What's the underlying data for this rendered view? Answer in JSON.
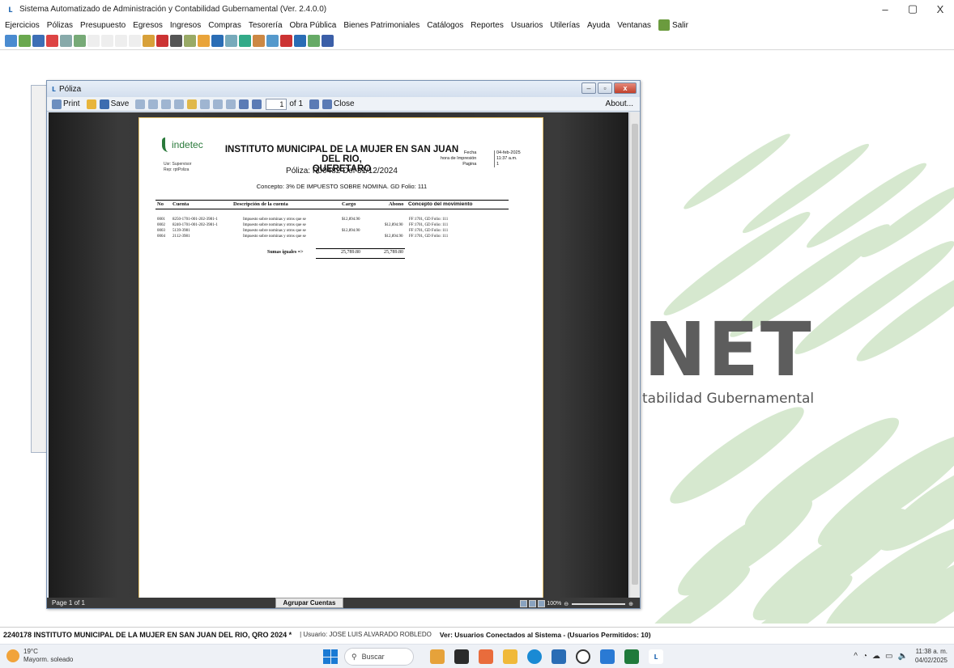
{
  "app": {
    "title": "Sistema Automatizado de Administración y Contabilidad Gubernamental  (Ver. 2.4.0.0)",
    "window_controls": [
      "–",
      "▢",
      "X"
    ]
  },
  "menu": [
    "Ejercicios",
    "Pólizas",
    "Presupuesto",
    "Egresos",
    "Ingresos",
    "Compras",
    "Tesorería",
    "Obra Pública",
    "Bienes Patrimoniales",
    "Catálogos",
    "Reportes",
    "Usuarios",
    "Utilerías",
    "Ayuda",
    "Ventanas"
  ],
  "menu_salir": "Salir",
  "toolbar_colors": [
    "#4a8bd0",
    "#6aa84f",
    "#3d6fb6",
    "#d44",
    "#8aa",
    "#7a7",
    "#eee",
    "#eee",
    "#eee",
    "#eee",
    "#d8a13a",
    "#c33",
    "#555",
    "#9a6",
    "#e9a43a",
    "#2a6db5",
    "#7ab",
    "#3a8",
    "#c84",
    "#59c",
    "#c33",
    "#2a6db5",
    "#6a6",
    "#3b5fa8"
  ],
  "background": {
    "logo_text": "NET",
    "sub_text": "tabilidad Gubernamental"
  },
  "viewer": {
    "title": "Póliza",
    "toolbar": {
      "print": "Print",
      "save": "Save",
      "page_value": "1",
      "of_label": "of 1",
      "close": "Close",
      "about": "About..."
    },
    "status_page": "Page 1 of 1",
    "agrupar": "Agrupar Cuentas",
    "zoom": "100%"
  },
  "report": {
    "logo_word": "indetec",
    "usr": "Usr: Supervisor",
    "rep": "Rep: rptPoliza",
    "title_line1": "INSTITUTO MUNICIPAL DE LA MUJER EN SAN JUAN DEL RIO,",
    "title_line2": "QUERETARO",
    "poliza_line": "Póliza:  P00482  Del 31/12/2024",
    "concepto": "Concepto: 3% DE IMPUESTO SOBRE NOMINA. GD Folio: 111",
    "fecha_labels": [
      "Fecha",
      "hora de Impresión",
      "Pagina"
    ],
    "fecha_values": [
      "04-feb-2025",
      "11:37 a.m.",
      "1"
    ],
    "headers": {
      "no": "No",
      "cuenta": "Cuenta",
      "descripcion": "Descripción de la cuenta",
      "cargo": "Cargo",
      "abono": "Abono",
      "concepto": "Concepto del movimiento"
    },
    "rows": [
      {
        "no": "0001",
        "cuenta": "8250-1701-001-202-3981-1",
        "desc": "Impuesto sobre nominas y otros que se",
        "cargo": "$12,894.90",
        "abono": "",
        "concepto": "FF:1701, GD Folio: 111"
      },
      {
        "no": "0002",
        "cuenta": "8240-1701-001-202-3981-1",
        "desc": "Impuesto sobre nominas y otros que se",
        "cargo": "",
        "abono": "$12,894.90",
        "concepto": "FF:1701, GD Folio: 111"
      },
      {
        "no": "0003",
        "cuenta": "5139-3981",
        "desc": "Impuesto sobre nominas y otros que se",
        "cargo": "$12,894.90",
        "abono": "",
        "concepto": "FF:1701, GD Folio: 111"
      },
      {
        "no": "0004",
        "cuenta": "2112-3981",
        "desc": "Impuesto sobre nominas y otros que se",
        "cargo": "",
        "abono": "$12,894.90",
        "concepto": "FF:1701, GD Folio: 111"
      }
    ],
    "sumas_label": "Sumas iguales =>",
    "sumas_cargo": "25,789.80",
    "sumas_abono": "25,789.80"
  },
  "statusbar": {
    "entity": "2240178 INSTITUTO MUNICIPAL DE LA MUJER EN SAN JUAN DEL RIO, QRO  2024  *",
    "user": "| Usuario: JOSE LUIS ALVARADO ROBLEDO",
    "connected": "Ver: Usuarios Conectados al Sistema - (Usuarios Permitidos: 10)"
  },
  "taskbar": {
    "temp": "19°C",
    "weather": "Mayorm. soleado",
    "search": "Buscar",
    "time": "11:38 a. m.",
    "date": "04/02/2025"
  }
}
